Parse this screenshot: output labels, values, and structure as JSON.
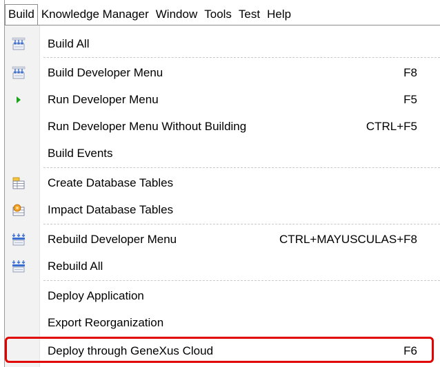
{
  "menubar": {
    "items": [
      "Build",
      "Knowledge Manager",
      "Window",
      "Tools",
      "Test",
      "Help"
    ],
    "active_index": 0
  },
  "menu": {
    "items": [
      {
        "label": "Build All",
        "shortcut": "",
        "icon": "build-all-icon"
      },
      {
        "label": "Build Developer Menu",
        "shortcut": "F8",
        "icon": "build-developer-menu-icon"
      },
      {
        "label": "Run Developer Menu",
        "shortcut": "F5",
        "icon": "run-triangle-icon"
      },
      {
        "label": "Run Developer Menu Without Building",
        "shortcut": "CTRL+F5",
        "icon": ""
      },
      {
        "label": "Build Events",
        "shortcut": "",
        "icon": ""
      },
      {
        "label": "Create Database Tables",
        "shortcut": "",
        "icon": "create-database-tables-icon"
      },
      {
        "label": "Impact Database Tables",
        "shortcut": "",
        "icon": "impact-database-tables-icon"
      },
      {
        "label": "Rebuild Developer Menu",
        "shortcut": "CTRL+MAYUSCULAS+F8",
        "icon": "rebuild-developer-menu-icon"
      },
      {
        "label": "Rebuild All",
        "shortcut": "",
        "icon": "rebuild-all-icon"
      },
      {
        "label": "Deploy Application",
        "shortcut": "",
        "icon": ""
      },
      {
        "label": "Export Reorganization",
        "shortcut": "",
        "icon": ""
      },
      {
        "label": "Deploy through GeneXus Cloud",
        "shortcut": "F6",
        "icon": ""
      }
    ]
  },
  "colors": {
    "highlight_border": "#e00000",
    "run_icon": "#1aa31a",
    "menu_background": "#ffffff",
    "icon_gutter": "#f2f2f2"
  }
}
